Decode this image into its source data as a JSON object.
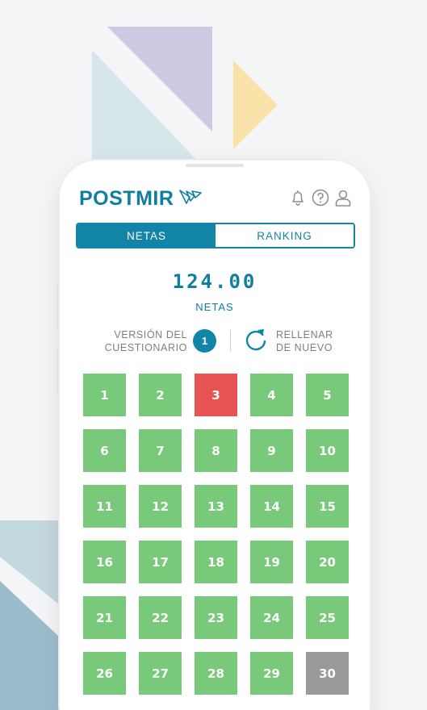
{
  "colors": {
    "brand": "#0f7f9e",
    "correct": "#79c97b",
    "wrong": "#e85454",
    "blank": "#9a9a9a"
  },
  "header": {
    "logo_text": "POSTMIR",
    "icons": [
      "bell-icon",
      "help-icon",
      "user-icon"
    ]
  },
  "tabs": [
    {
      "label": "NETAS",
      "active": true
    },
    {
      "label": "RANKING",
      "active": false
    }
  ],
  "score": {
    "value": "124.00",
    "label": "NETAS"
  },
  "version": {
    "label_line1": "VERSIÓN DEL",
    "label_line2": "CUESTIONARIO",
    "number": "1"
  },
  "refill": {
    "line1": "RELLENAR",
    "line2": "DE NUEVO"
  },
  "questions": [
    {
      "n": "1",
      "status": "correct"
    },
    {
      "n": "2",
      "status": "correct"
    },
    {
      "n": "3",
      "status": "wrong"
    },
    {
      "n": "4",
      "status": "correct"
    },
    {
      "n": "5",
      "status": "correct"
    },
    {
      "n": "6",
      "status": "correct"
    },
    {
      "n": "7",
      "status": "correct"
    },
    {
      "n": "8",
      "status": "correct"
    },
    {
      "n": "9",
      "status": "correct"
    },
    {
      "n": "10",
      "status": "correct"
    },
    {
      "n": "11",
      "status": "correct"
    },
    {
      "n": "12",
      "status": "correct"
    },
    {
      "n": "13",
      "status": "correct"
    },
    {
      "n": "14",
      "status": "correct"
    },
    {
      "n": "15",
      "status": "correct"
    },
    {
      "n": "16",
      "status": "correct"
    },
    {
      "n": "17",
      "status": "correct"
    },
    {
      "n": "18",
      "status": "correct"
    },
    {
      "n": "19",
      "status": "correct"
    },
    {
      "n": "20",
      "status": "correct"
    },
    {
      "n": "21",
      "status": "correct"
    },
    {
      "n": "22",
      "status": "correct"
    },
    {
      "n": "23",
      "status": "correct"
    },
    {
      "n": "24",
      "status": "correct"
    },
    {
      "n": "25",
      "status": "correct"
    },
    {
      "n": "26",
      "status": "correct"
    },
    {
      "n": "27",
      "status": "correct"
    },
    {
      "n": "28",
      "status": "correct"
    },
    {
      "n": "29",
      "status": "correct"
    },
    {
      "n": "30",
      "status": "blank"
    }
  ]
}
